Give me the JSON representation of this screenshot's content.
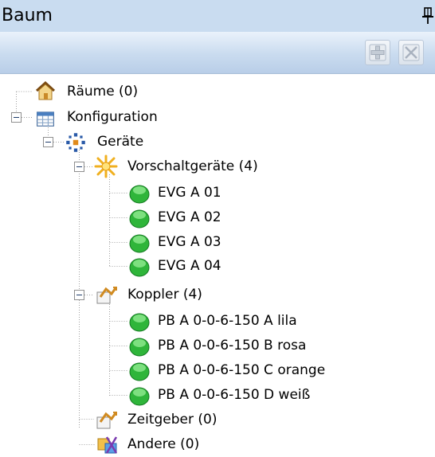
{
  "panel": {
    "title": "Baum"
  },
  "toolbar": {
    "add_tooltip": "",
    "remove_tooltip": ""
  },
  "tree": {
    "raeume": "Räume (0)",
    "konfiguration": "Konfiguration",
    "geraete": "Geräte",
    "vorschaltgeraete": "Vorschaltgeräte (4)",
    "evg": [
      "EVG A 01",
      "EVG A 02",
      "EVG A 03",
      "EVG A 04"
    ],
    "koppler": "Koppler (4)",
    "pb": [
      "PB A 0-0-6-150 A lila",
      "PB A 0-0-6-150 B rosa",
      "PB A 0-0-6-150 C orange",
      "PB A 0-0-6-150 D weiß"
    ],
    "zeitgeber": "Zeitgeber (0)",
    "andere": "Andere (0)"
  },
  "colors": {
    "titlebar": "#c9dcf0",
    "device_green": "#2fb53a",
    "accent_blue": "#1e3c6b"
  }
}
